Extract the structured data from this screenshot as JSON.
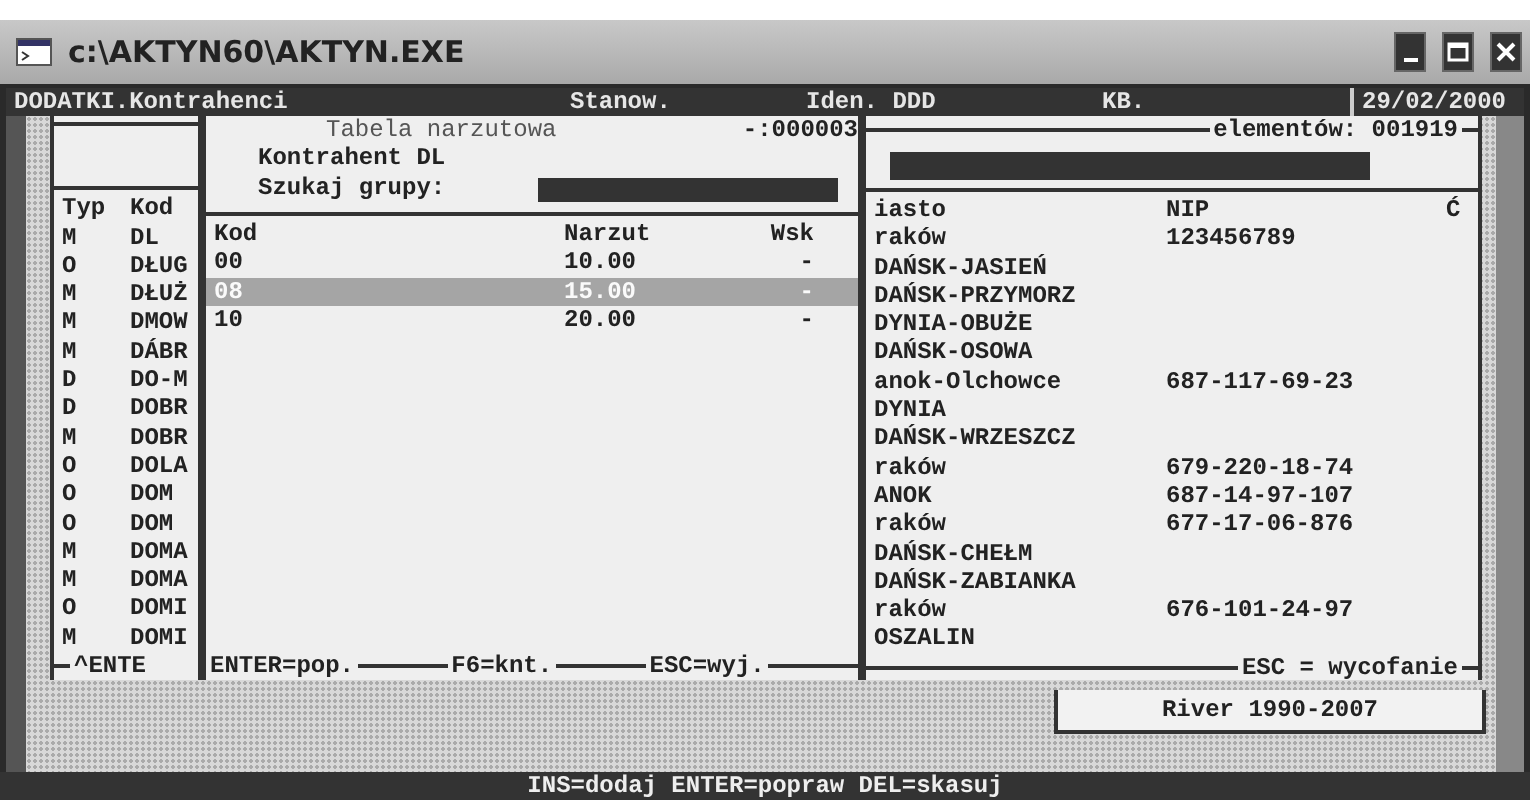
{
  "window": {
    "title": "c:\\AKTYN60\\AKTYN.EXE"
  },
  "menu_bar": [
    "DODATKI.Kontrahenci",
    "Stanow.",
    "Iden. DDD",
    "KB.",
    "29/02/2000"
  ],
  "group_panel": {
    "columns": [
      "Typ",
      "Kod"
    ],
    "rows": [
      {
        "typ": "M",
        "kod": "DL"
      },
      {
        "typ": "O",
        "kod": "DŁUG"
      },
      {
        "typ": "M",
        "kod": "DŁUŻ"
      },
      {
        "typ": "M",
        "kod": "DMOW"
      },
      {
        "typ": "M",
        "kod": "DÁBR"
      },
      {
        "typ": "D",
        "kod": "DO-M"
      },
      {
        "typ": "D",
        "kod": "DOBR"
      },
      {
        "typ": "M",
        "kod": "DOBR"
      },
      {
        "typ": "O",
        "kod": "DOLA"
      },
      {
        "typ": "O",
        "kod": "DOM"
      },
      {
        "typ": "O",
        "kod": "DOM"
      },
      {
        "typ": "M",
        "kod": "DOMA"
      },
      {
        "typ": "M",
        "kod": "DOMA"
      },
      {
        "typ": "O",
        "kod": "DOMI"
      },
      {
        "typ": "M",
        "kod": "DOMI"
      }
    ],
    "footer": "^ENTE"
  },
  "markup_table": {
    "title": "Tabela narzutowa",
    "counter": "-:000003",
    "contractor": "Kontrahent DL",
    "search": {
      "label": "Szukaj grupy:"
    },
    "columns": [
      "Kod",
      "Narzut",
      "Wsk"
    ],
    "rows": [
      {
        "kod": "00",
        "narzut": "10.00",
        "wsk": "-",
        "selected": false
      },
      {
        "kod": "08",
        "narzut": "15.00",
        "wsk": "-",
        "selected": true
      },
      {
        "kod": "10",
        "narzut": "20.00",
        "wsk": "-",
        "selected": false
      }
    ],
    "footer": [
      "ENTER=pop.",
      "F6=knt.",
      "ESC=wyj."
    ]
  },
  "contractors_panel": {
    "count": "elementów: 001919",
    "columns": [
      "iasto",
      "NIP",
      "Ć"
    ],
    "rows": [
      {
        "city": "raków",
        "nip": "123456789"
      },
      {
        "city": "DAŃSK-JASIEŃ"
      },
      {
        "city": "DAŃSK-PRZYMORZ"
      },
      {
        "city": "DYNIA-OBUŻE"
      },
      {
        "city": "DAŃSK-OSOWA"
      },
      {
        "city": "anok-Olchowce",
        "nip": "687-117-69-23"
      },
      {
        "city": "DYNIA"
      },
      {
        "city": "DAŃSK-WRZESZCZ"
      },
      {
        "city": "raków",
        "nip": "679-220-18-74"
      },
      {
        "city": "ANOK",
        "nip": "687-14-97-107"
      },
      {
        "city": "raków",
        "nip": "677-17-06-876"
      },
      {
        "city": "DAŃSK-CHEŁM"
      },
      {
        "city": "DAŃSK-ZABIANKA"
      },
      {
        "city": "raków",
        "nip": "676-101-24-97"
      },
      {
        "city": "OSZALIN"
      }
    ],
    "footer": "ESC = wycofanie"
  },
  "version_box": "River 1990-2007",
  "status_bar": "INS=dodaj ENTER=popraw DEL=skasuj"
}
